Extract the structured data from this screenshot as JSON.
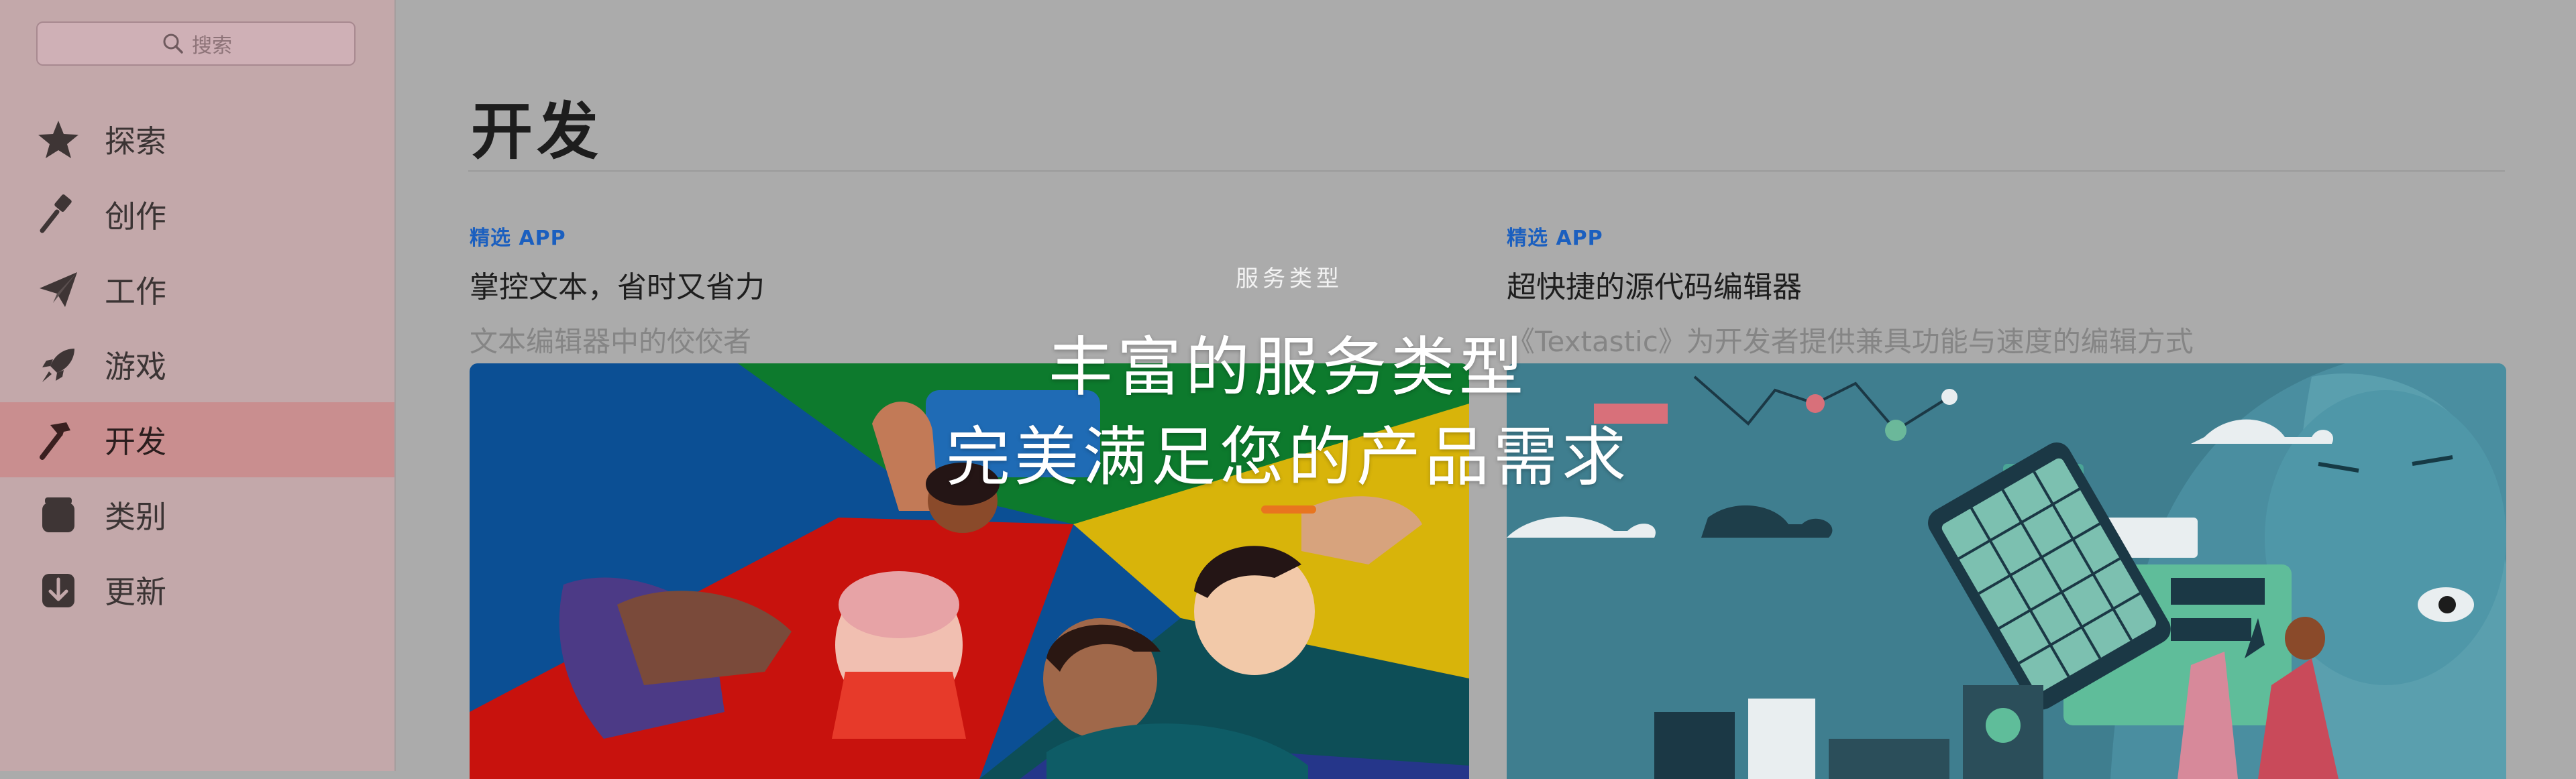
{
  "sidebar": {
    "search": {
      "placeholder": "搜索"
    },
    "items": [
      {
        "label": "探索",
        "icon": "star-icon"
      },
      {
        "label": "创作",
        "icon": "paintbrush-icon"
      },
      {
        "label": "工作",
        "icon": "paperplane-icon"
      },
      {
        "label": "游戏",
        "icon": "rocket-icon"
      },
      {
        "label": "开发",
        "icon": "hammer-icon",
        "active": true
      },
      {
        "label": "类别",
        "icon": "stack-icon"
      },
      {
        "label": "更新",
        "icon": "download-icon"
      }
    ]
  },
  "main": {
    "title": "开发",
    "cards": [
      {
        "tag": "精选 APP",
        "title": "掌控文本，省时又省力",
        "subtitle": "文本编辑器中的佼佼者"
      },
      {
        "tag": "精选 APP",
        "title": "超快捷的源代码编辑器",
        "subtitle": "《Textastic》为开发者提供兼具功能与速度的编辑方式"
      }
    ]
  },
  "overlay": {
    "small": "服务类型",
    "line1": "丰富的服务类型",
    "line2": "完美满足您的产品需求"
  },
  "colors": {
    "accent_tag": "#1b5fbf",
    "sidebar_active": "#c98e8f",
    "overlay_bar": "#e8751f"
  }
}
